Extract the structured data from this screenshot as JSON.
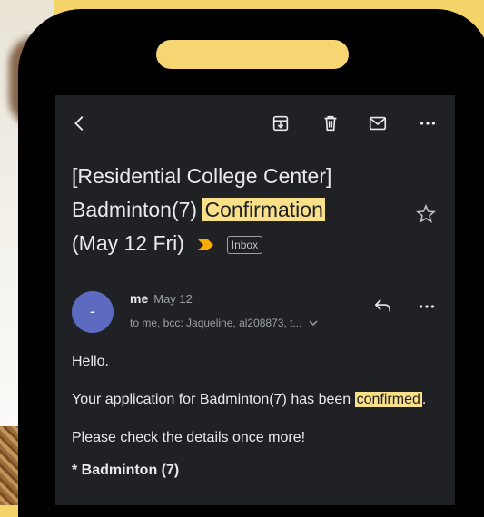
{
  "email": {
    "subject_part1": "[Residential College Center] Badminton(7) ",
    "subject_highlight": "Confirmation",
    "subject_part2": "(May 12 Fri)",
    "label_chip": "Inbox",
    "sender": {
      "avatar_letter": "-",
      "name": "me",
      "date": "May 12",
      "recipients": "to me, bcc: Jaqueline, al208873, t..."
    },
    "body": {
      "greeting": "Hello.",
      "line1_part1": "Your application for Badminton(7) has been ",
      "line1_highlight": "confirmed",
      "line1_part2": ".",
      "line2": "Please check the details once more!",
      "line3": "* Badminton (7)"
    }
  },
  "colors": {
    "background": "#f4d469",
    "screen": "#202124",
    "highlight": "#fbe08a",
    "avatar": "#5c6bc0",
    "important_marker": "#f9ab00"
  },
  "icons": [
    "back-arrow-icon",
    "archive-icon",
    "trash-icon",
    "mail-icon",
    "more-icon",
    "star-icon",
    "reply-icon",
    "chevron-down-icon",
    "important-marker-icon"
  ]
}
